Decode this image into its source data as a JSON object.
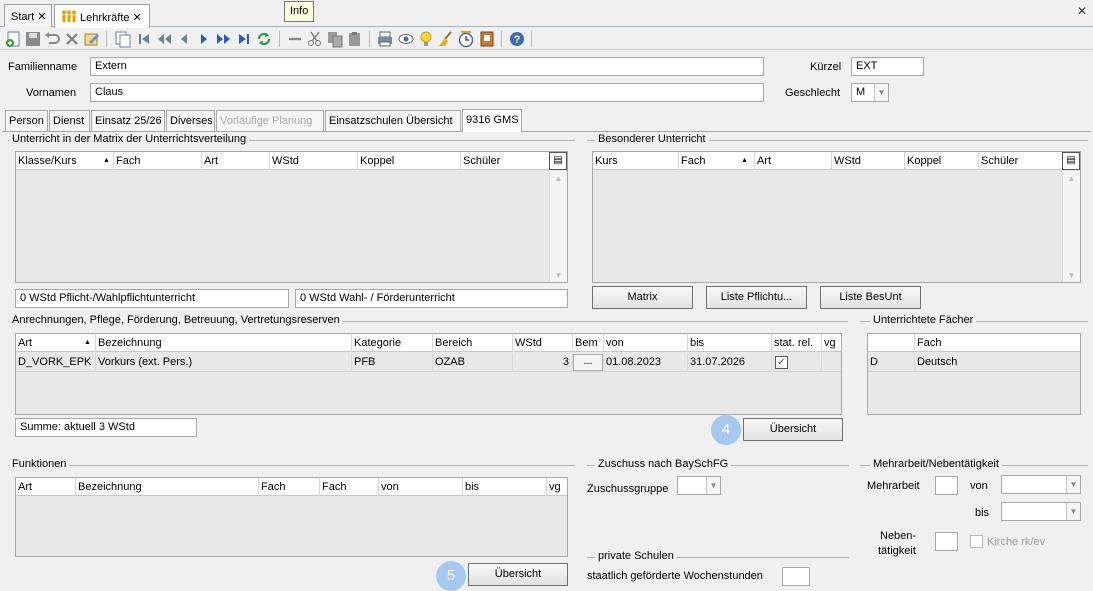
{
  "tabs": {
    "start": "Start",
    "lehrkraefte": "Lehrkräfte",
    "close_glyph": "✕"
  },
  "tooltip": "Info",
  "toolbar_icons": [
    "new-icon",
    "save-icon",
    "undo-icon",
    "delete-icon",
    "edit-icon",
    "copy-record-icon",
    "first-icon",
    "prev-page-icon",
    "prev-icon",
    "next-icon",
    "next-page-icon",
    "last-icon",
    "refresh-icon",
    "remove-icon",
    "cut-icon",
    "copy-icon",
    "paste-icon",
    "print-icon",
    "preview-icon",
    "idea-icon",
    "broom-icon",
    "clock-icon",
    "document-icon",
    "help-icon"
  ],
  "header": {
    "familienname_label": "Familienname",
    "familienname_value": "Extern",
    "vornamen_label": "Vornamen",
    "vornamen_value": "Claus",
    "kuerzel_label": "Kürzel",
    "kuerzel_value": "EXT",
    "geschlecht_label": "Geschlecht",
    "geschlecht_value": "M"
  },
  "inner_tabs": [
    "Person",
    "Dienst",
    "Einsatz 25/26",
    "Diverses",
    "Vorläufige Planung",
    "Einsatzschulen Übersicht",
    "9316 GMS"
  ],
  "unterricht": {
    "title": "Unterricht in der Matrix der Unterrichtsverteilung",
    "columns": [
      "Klasse/Kurs",
      "Fach",
      "Art",
      "WStd",
      "Koppel",
      "Schüler"
    ],
    "pflicht_summary": "0 WStd Pflicht-/Wahlpflichtunterricht",
    "wahl_summary": "0 WStd Wahl- / Förderunterricht"
  },
  "besonderer": {
    "title": "Besonderer Unterricht",
    "columns": [
      "Kurs",
      "Fach",
      "Art",
      "WStd",
      "Koppel",
      "Schüler"
    ],
    "buttons": [
      "Matrix",
      "Liste Pflichtu...",
      "Liste BesUnt"
    ]
  },
  "anrechnungen": {
    "title": "Anrechnungen, Pflege, Förderung, Betreuung, Vertretungsreserven",
    "columns": [
      "Art",
      "Bezeichnung",
      "Kategorie",
      "Bereich",
      "WStd",
      "Bem",
      "von",
      "bis",
      "stat. rel.",
      "vg"
    ],
    "rows": [
      {
        "art": "D_VORK_EPK",
        "bezeichnung": "Vorkurs (ext. Pers.)",
        "kategorie": "PFB",
        "bereich": "OZAB",
        "wstd": "3",
        "bem": "...",
        "von": "01.08.2023",
        "bis": "31.07.2026",
        "stat_rel": "✓"
      }
    ],
    "summe": "Summe: aktuell 3 WStd",
    "badge": "4",
    "button": "Übersicht"
  },
  "faecher": {
    "title": "Unterrichtete Fächer",
    "columns": [
      "",
      "Fach"
    ],
    "rows": [
      {
        "code": "D",
        "fach": "Deutsch"
      }
    ]
  },
  "funktionen": {
    "title": "Funktionen",
    "columns": [
      "Art",
      "Bezeichnung",
      "Fach",
      "Fach",
      "von",
      "bis",
      "vg"
    ],
    "badge": "5",
    "button": "Übersicht"
  },
  "zuschuss": {
    "title": "Zuschuss nach BaySchFG",
    "gruppe_label": "Zuschussgruppe"
  },
  "private_schulen": {
    "title": "private Schulen",
    "label": "staatlich geförderte Wochenstunden"
  },
  "mehrarbeit": {
    "title": "Mehrarbeit/Nebentätigkeit",
    "mehrarbeit_label": "Mehrarbeit",
    "von_label": "von",
    "bis_label": "bis",
    "neben_label_1": "Neben-",
    "neben_label_2": "tätigkeit",
    "kirche_label": "Kirche rk/ev"
  }
}
